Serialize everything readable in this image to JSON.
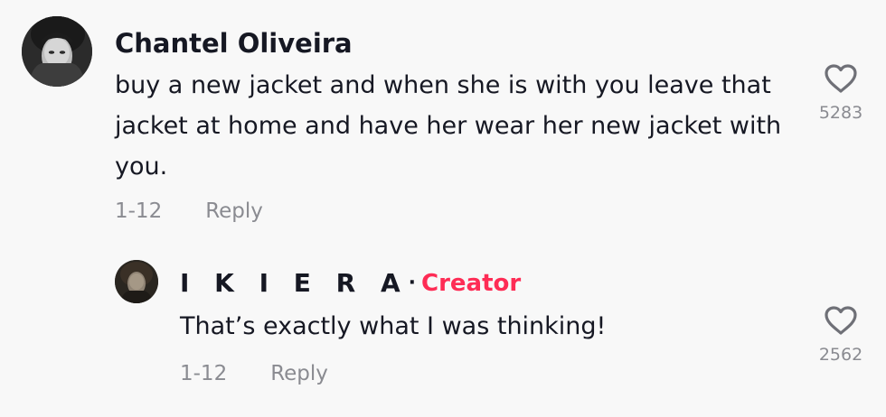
{
  "comments": [
    {
      "author": "Chantel Oliveira",
      "text": "buy a new jacket and when she is with you leave that jacket at home and have her wear her new jacket with you.",
      "date": "1-12",
      "reply_label": "Reply",
      "likes": "5283",
      "like_icon": "heart-outline-icon",
      "replies": [
        {
          "author": "I K I E R A",
          "separator": "·",
          "badge": "Creator",
          "text": "That’s exactly what I was thinking!",
          "date": "1-12",
          "reply_label": "Reply",
          "likes": "2562",
          "like_icon": "heart-outline-icon"
        }
      ]
    }
  ],
  "colors": {
    "background": "#f8f8f8",
    "text": "#161823",
    "muted": "#8a8b91",
    "creator_badge": "#fe2c55"
  }
}
